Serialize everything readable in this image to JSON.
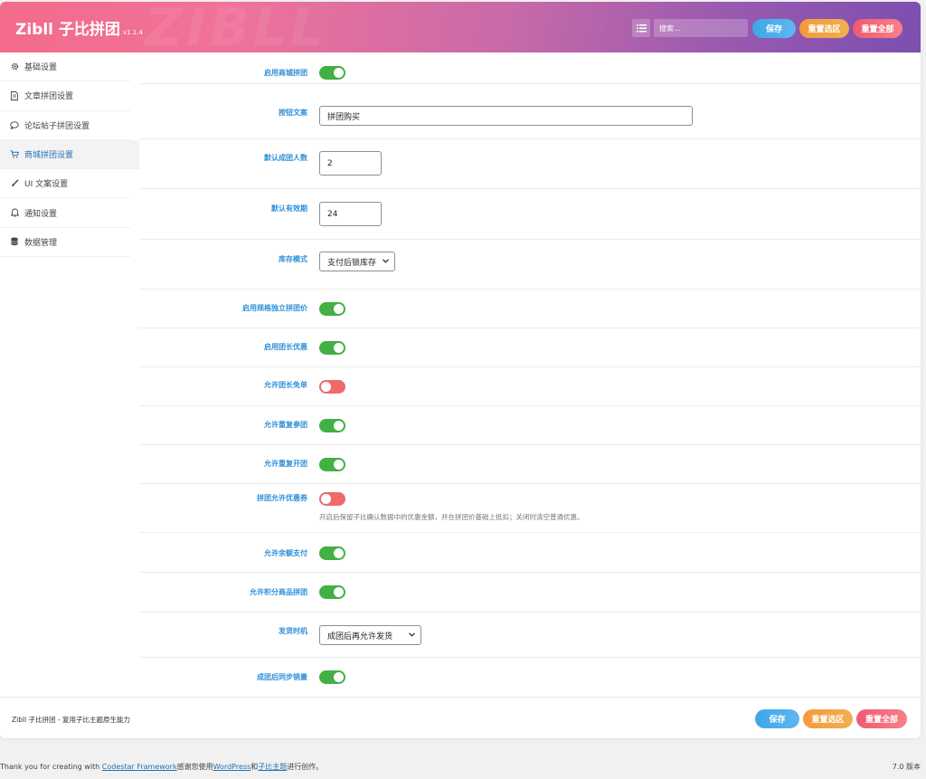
{
  "header": {
    "brand": "Zibll 子比拼团",
    "version": "v1.1.4",
    "watermark": "ZIBLL",
    "search_placeholder": "搜索...",
    "save_label": "保存",
    "reset_section_label": "重置选区",
    "reset_all_label": "重置全部"
  },
  "sidebar": {
    "items": [
      {
        "label": "基础设置",
        "icon": "gear-icon"
      },
      {
        "label": "文章拼团设置",
        "icon": "document-icon"
      },
      {
        "label": "论坛帖子拼团设置",
        "icon": "chat-icon"
      },
      {
        "label": "商城拼团设置",
        "icon": "cart-icon"
      },
      {
        "label": "UI 文案设置",
        "icon": "brush-icon"
      },
      {
        "label": "通知设置",
        "icon": "bell-icon"
      },
      {
        "label": "数据管理",
        "icon": "database-icon"
      }
    ],
    "active_index": 3
  },
  "settings": {
    "enable_shop_group": {
      "label": "启用商城拼团",
      "value": true
    },
    "button_text": {
      "label": "按钮文案",
      "value": "拼团购买"
    },
    "default_group_size": {
      "label": "默认成团人数",
      "value": "2"
    },
    "default_validity": {
      "label": "默认有效期",
      "value": "24"
    },
    "stock_mode": {
      "label": "库存模式",
      "value": "支付后锁库存"
    },
    "enable_spec_price": {
      "label": "启用规格独立拼团价",
      "value": true
    },
    "enable_leader_discount": {
      "label": "启用团长优惠",
      "value": true
    },
    "allow_leader_free": {
      "label": "允许团长免单",
      "value": false
    },
    "allow_rejoin": {
      "label": "允许重复参团",
      "value": true
    },
    "allow_reopen": {
      "label": "允许重复开团",
      "value": true
    },
    "allow_coupon": {
      "label": "拼团允许优惠券",
      "value": false,
      "desc": "开启后保留子比确认数据中的优惠金额，并在拼团价基础上抵扣；关闭时清空普通优惠。"
    },
    "allow_balance": {
      "label": "允许余额支付",
      "value": true
    },
    "allow_points_goods": {
      "label": "允许积分商品拼团",
      "value": true
    },
    "ship_timing": {
      "label": "发货时机",
      "value": "成团后再允许发货"
    },
    "sync_sales": {
      "label": "成团后同步销量",
      "value": true
    }
  },
  "footer": {
    "note": "Zibll 子比拼团 - 复用子比主题原生能力",
    "save_label": "保存",
    "reset_section_label": "重置选区",
    "reset_all_label": "重置全部"
  },
  "wp_footer": {
    "text_prefix": "Thank you for creating with ",
    "codestar_link": "Codestar Framework",
    "text_mid": "感谢您使用",
    "wordpress_link": "WordPress",
    "text_and": "和",
    "zibll_link": "子比主题",
    "text_suffix": "进行创作。",
    "version": "7.0 版本"
  },
  "colors": {
    "toggle_on": "#42b043",
    "toggle_off": "#ef6a6a",
    "label_blue": "#2f8fd8",
    "btn_blue": "#3da7e8",
    "btn_orange": "#f49a3a",
    "btn_red": "#f05a72"
  }
}
